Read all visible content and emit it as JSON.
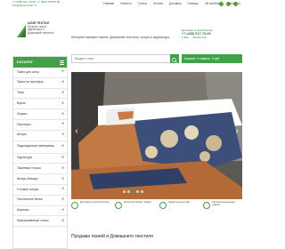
{
  "topbar": {
    "phone1": "+7 (495) 517-79-96, +7 (964) 755-50-99",
    "email": "info@tkani-textile.ru",
    "nav": [
      "Главная",
      "Новости",
      "Статьи",
      "Оплата",
      "Доставка",
      "Помощь",
      "Об изобилии",
      "Контакты"
    ]
  },
  "header": {
    "logo_name": "AZUR TEXTILE",
    "logo_tagline": "Лучшие ткани, фурнитура и Домашний текстиль",
    "description": "Интернет магазин тканей, Домашний текстиль, шторы и фурнитура.",
    "delivery": "Доставка по всей России",
    "phone": "+7 (495) 517-79-96",
    "city_options": [
      "Все",
      "Областной"
    ]
  },
  "sidebar": {
    "title": "КАТАЛОГ",
    "items": [
      "Ткани для штор",
      "Ткани на портьеры",
      "Тюль",
      "Вуаль",
      "Люрекс",
      "Портьеры",
      "Шторы",
      "Подкладочные материалы",
      "Фурнитура",
      "Тканевые стулья",
      "Шторы блэкаут",
      "Готовые шторы",
      "Постельное белье",
      "Карнизы",
      "Мазсированные стопы"
    ]
  },
  "search": {
    "placeholder": "Введите ткань",
    "cart_label": "Корзина: 0 товаров - 0 руб"
  },
  "features": [
    "Доставка по всей России",
    "Большой выбор тканей",
    "Гарантия качества",
    "Профессиональные советы"
  ],
  "section_title": "Продажа тканей и Домашнего текстиля",
  "colors": {
    "accent": "#43a047",
    "text": "#333333"
  }
}
